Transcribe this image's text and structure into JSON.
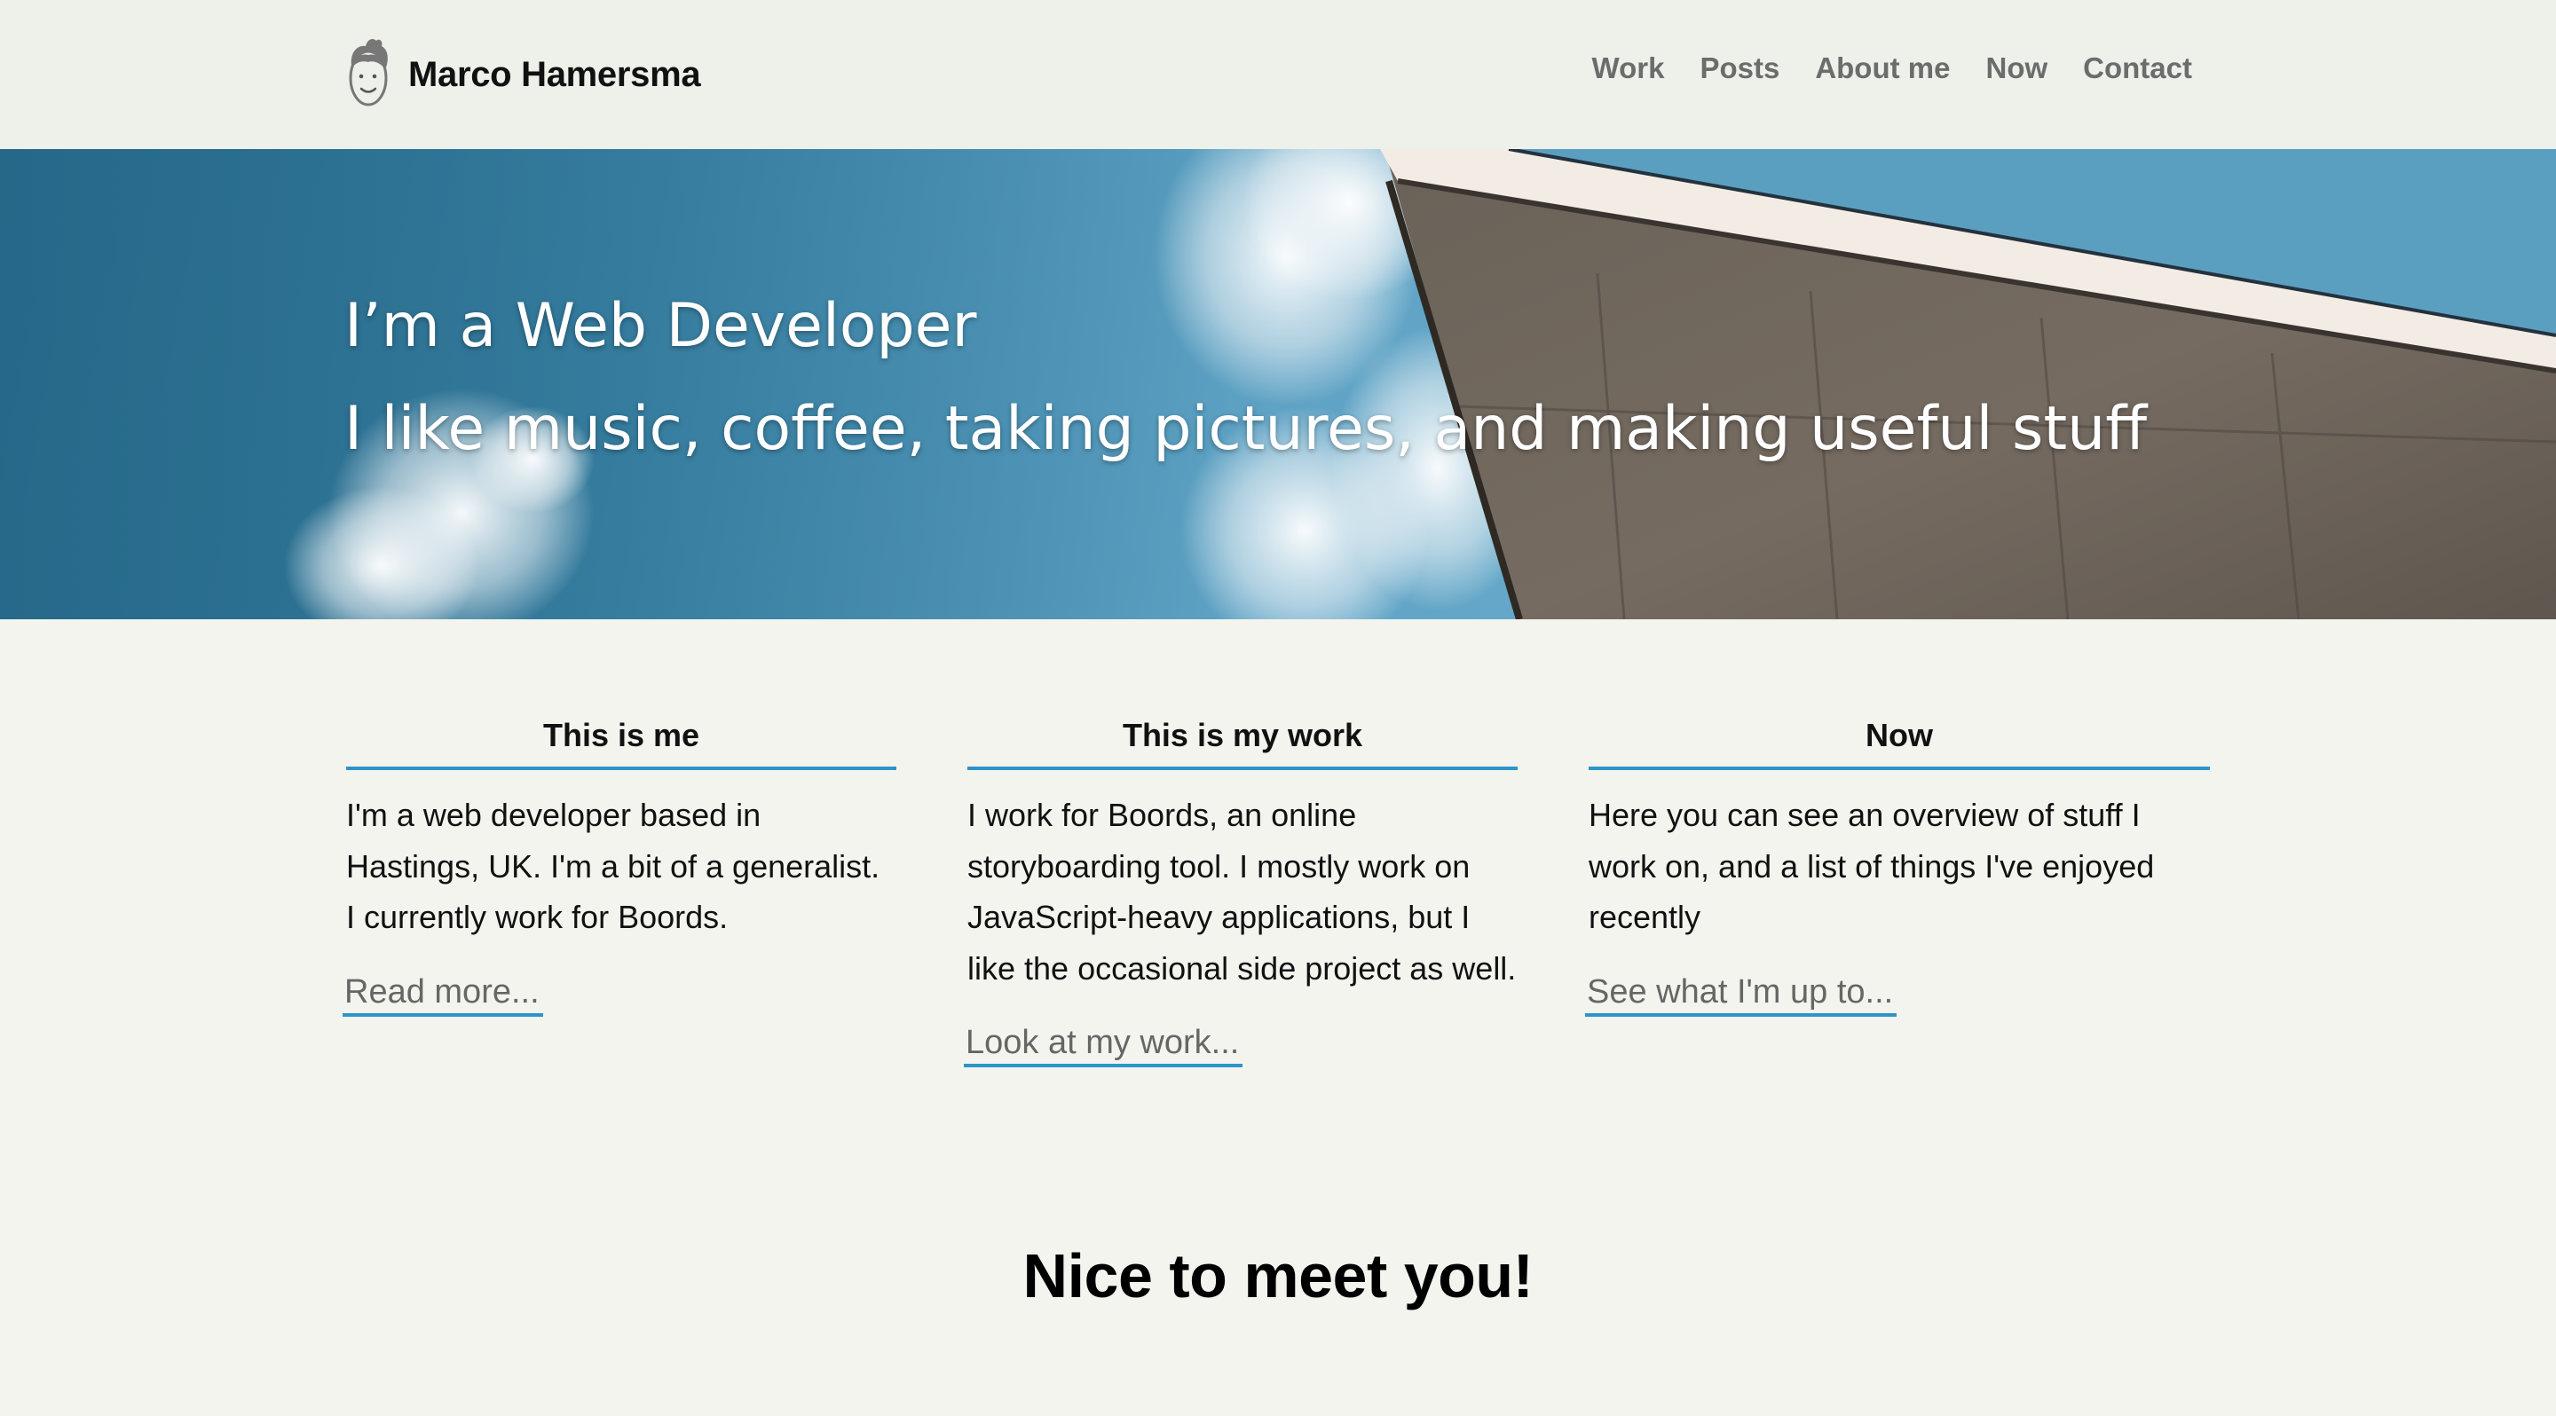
{
  "header": {
    "brand_name": "Marco Hamersma",
    "nav": [
      {
        "label": "Work"
      },
      {
        "label": "Posts"
      },
      {
        "label": "About me"
      },
      {
        "label": "Now"
      },
      {
        "label": "Contact"
      }
    ]
  },
  "hero": {
    "title": "I’m a Web Developer",
    "subtitle": "I like music, coffee, taking pictures, and making useful stuff"
  },
  "columns": [
    {
      "heading": "This is me",
      "body": "I'm a web developer based in Hastings, UK. I'm a bit of a generalist. I currently work for Boords.",
      "link": "Read more..."
    },
    {
      "heading": "This is my work",
      "body": "I work for Boords, an online storyboarding tool. I mostly work on JavaScript-heavy applications, but I like the occasional side project as well.",
      "link": "Look at my work..."
    },
    {
      "heading": "Now",
      "body": "Here you can see an overview of stuff I work on, and a list of things I've enjoyed recently",
      "link": "See what I'm up to..."
    }
  ],
  "closing": {
    "title": "Nice to meet you!"
  },
  "colors": {
    "accent": "#2c95c8",
    "page_background": "#f4f4ef",
    "header_background": "#eef0ea",
    "nav_text": "#6c6c6c"
  }
}
